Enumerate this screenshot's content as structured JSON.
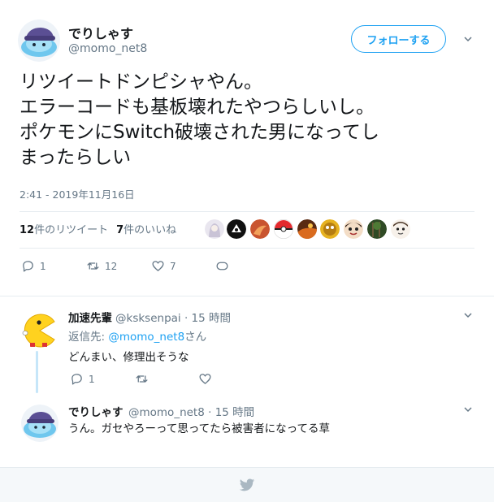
{
  "author": {
    "name": "でりしゃす",
    "handle": "@momo_net8"
  },
  "follow_label": "フォローする",
  "tweet": {
    "lines": [
      "リツイートドンピシャやん。",
      "エラーコードも基板壊れたやつらしいし。",
      "ポケモンにSwitch破壊された男になってし",
      "まったらしい"
    ],
    "timestamp": "2:41 - 2019年11月16日"
  },
  "stats": {
    "retweets_count": "12",
    "retweets_label": "件のリツイート",
    "likes_count": "7",
    "likes_label": "件のいいね"
  },
  "actions": {
    "reply_count": "1",
    "retweet_count": "12",
    "like_count": "7"
  },
  "replies": [
    {
      "name": "加速先輩",
      "meta": "@ksksenpai · 15 時間",
      "reply_to_prefix": "返信先: ",
      "reply_to_handle": "@momo_net8",
      "reply_to_suffix": "さん",
      "text": "どんまい、修理出そうな",
      "reply_count": "1"
    },
    {
      "name": "でりしゃす",
      "meta": "@momo_net8 · 15 時間",
      "text": "うん。ガセやろーって思ってたら被害者になってる草"
    }
  ],
  "colors": {
    "accent": "#1da1f2",
    "secondary_text": "#657786",
    "border": "#e6ecf0"
  },
  "icons": [
    "reply-icon",
    "retweet-icon",
    "like-icon",
    "dm-icon",
    "chevron-down-icon",
    "twitter-bird-icon"
  ]
}
